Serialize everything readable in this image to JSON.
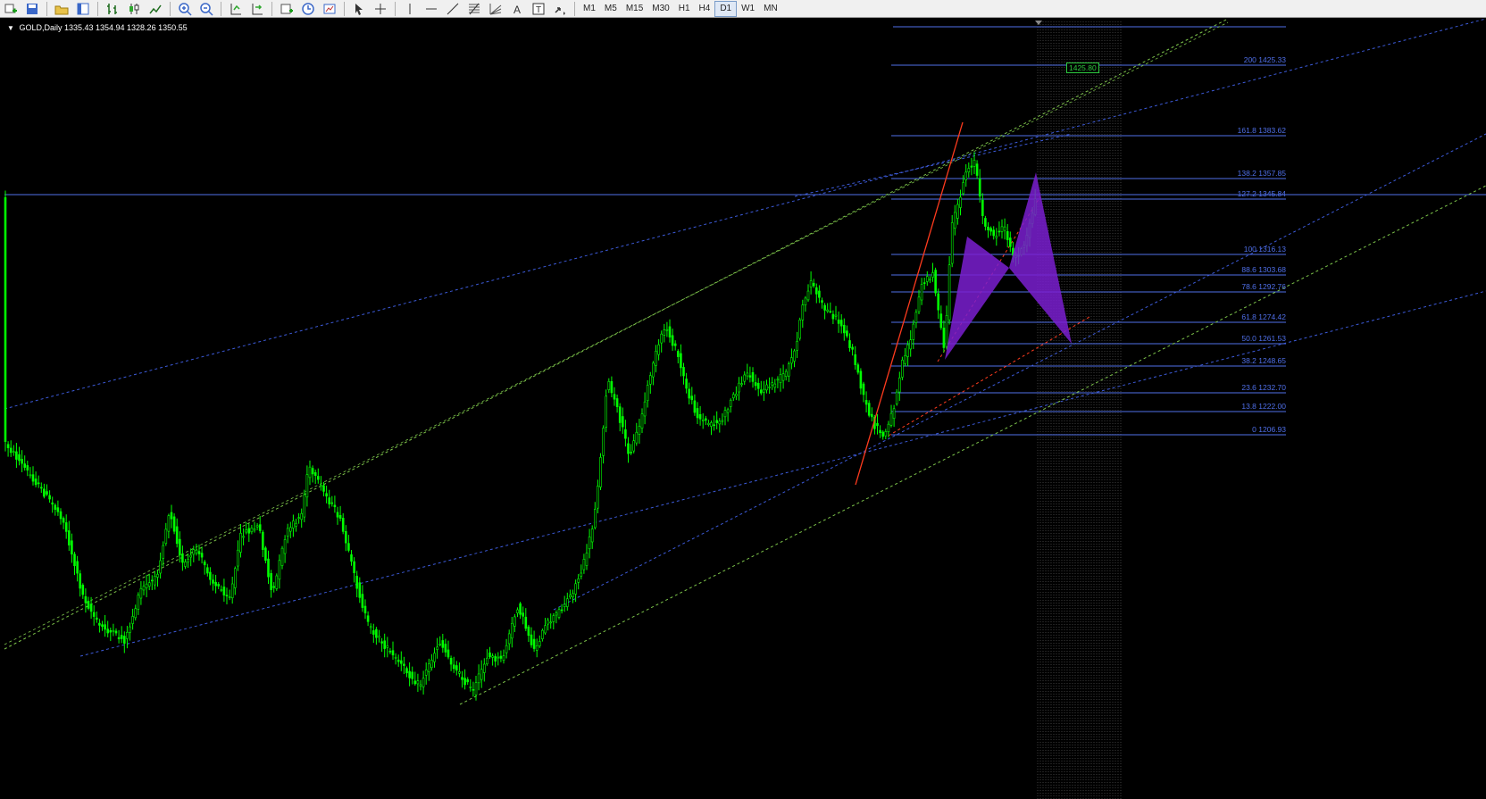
{
  "toolbar": {
    "icons": [
      "new-chart-icon",
      "save-icon",
      "folder-icon",
      "window-icon",
      "bar-chart-icon",
      "candlestick-icon",
      "line-chart-icon",
      "zoom-in-icon",
      "zoom-out-icon",
      "chart-shift-icon",
      "autoscroll-icon",
      "add-indicator-icon",
      "period-icon",
      "template-icon",
      "cursor-icon",
      "crosshair-icon",
      "vertical-line-icon",
      "horizontal-line-icon",
      "trendline-icon",
      "fibonacci-icon",
      "text-icon",
      "text-label-icon",
      "arrows-icon"
    ],
    "timeframes": [
      "M1",
      "M5",
      "M15",
      "M30",
      "H1",
      "H4",
      "D1",
      "W1",
      "MN"
    ],
    "active_timeframe": "D1"
  },
  "symbol": {
    "label": "GOLD,Daily",
    "ohlc": "1335.43 1354.94 1328.26 1350.55"
  },
  "fib_levels": [
    {
      "label": "200 1425.33"
    },
    {
      "label": "161.8 1383.62"
    },
    {
      "label": "138.2 1357.85"
    },
    {
      "label": "127.2 1345.84"
    },
    {
      "label": "100 1316.13"
    },
    {
      "label": "88.6 1303.68"
    },
    {
      "label": "78.6 1292.76"
    },
    {
      "label": "61.8 1274.42"
    },
    {
      "label": "50.0 1261.53"
    },
    {
      "label": "38.2 1248.65"
    },
    {
      "label": "23.6 1232.70"
    },
    {
      "label": "13.8 1222.00"
    },
    {
      "label": "0 1206.93"
    }
  ],
  "price_box": "1425.80",
  "colors": {
    "background": "#000000",
    "candles": "#00ff00",
    "fib": "#4f6fe8",
    "channel_green": "#7cc34a",
    "channel_blue": "#3c5ad8",
    "pattern": "#7a1fd0",
    "red_line": "#ff3b1e"
  }
}
